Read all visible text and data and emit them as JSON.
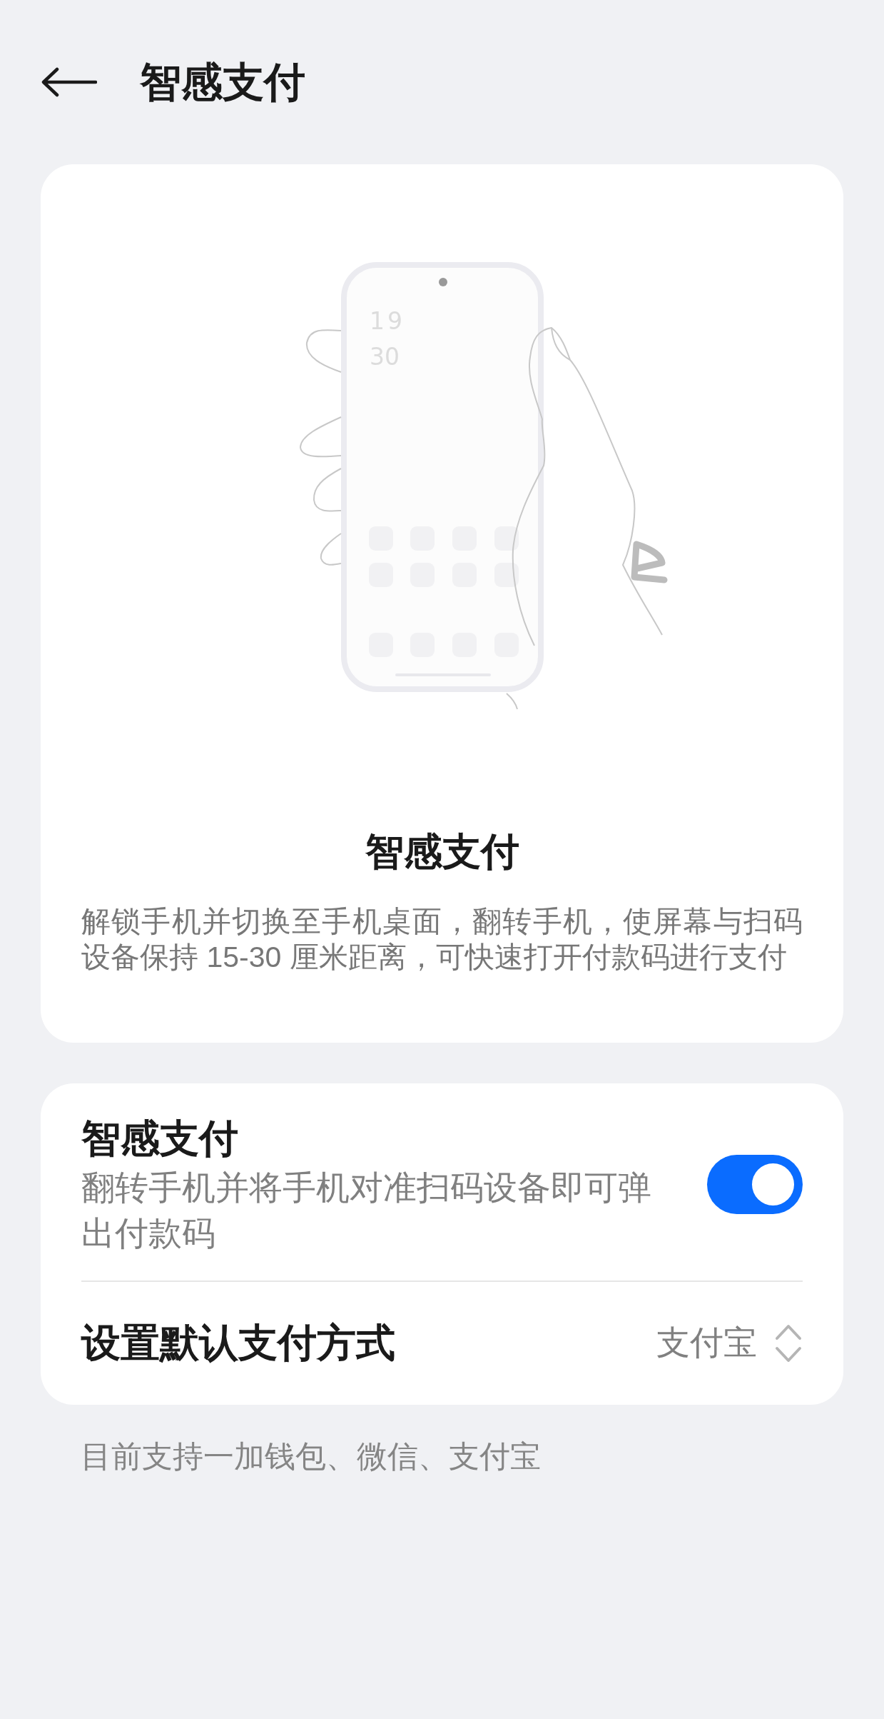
{
  "header": {
    "title": "智感支付"
  },
  "intro_card": {
    "illustration": {
      "clock_hour": "19",
      "clock_minute": "30"
    },
    "title": "智感支付",
    "description": "解锁手机并切换至手机桌面，翻转手机，使屏幕与扫码设备保持 15-30 厘米距离，可快速打开付款码进行支付"
  },
  "settings": [
    {
      "kind": "toggle",
      "title": "智感支付",
      "subtitle": "翻转手机并将手机对准扫码设备即可弹出付款码",
      "on": true
    },
    {
      "kind": "select",
      "title": "设置默认支付方式",
      "value": "支付宝"
    }
  ],
  "footnote": "目前支持一加钱包、微信、支付宝"
}
